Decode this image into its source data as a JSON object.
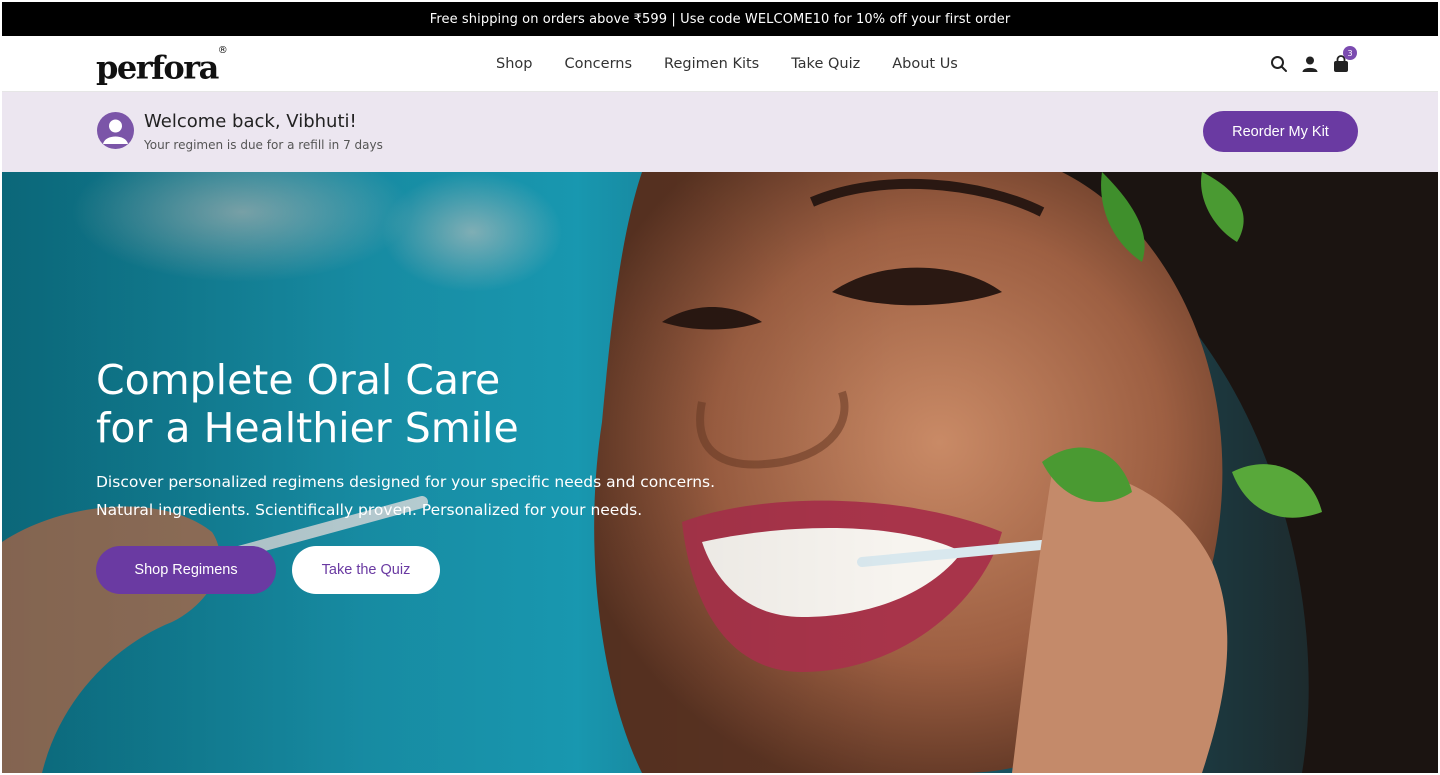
{
  "announcement": {
    "text": "Free shipping on orders above ₹599 | Use code WELCOME10 for 10% off your first order"
  },
  "header": {
    "logo_text": "perfora",
    "logo_mark": "®",
    "nav": [
      "Shop",
      "Concerns",
      "Regimen Kits",
      "Take Quiz",
      "About Us"
    ],
    "icons": [
      "search-icon",
      "user-icon",
      "cart-icon"
    ],
    "cart_count": "3"
  },
  "welcome": {
    "title": "Welcome back, Vibhuti!",
    "subtitle": "Your regimen is due for a refill in 7 days",
    "button": "Reorder My Kit"
  },
  "hero": {
    "title_line1": "Complete Oral Care",
    "title_line2": "for a Healthier Smile",
    "desc_line1": "Discover personalized regimens designed for your specific needs and concerns.",
    "desc_line2": "Natural ingredients. Scientifically proven. Personalized for your needs.",
    "primary_button": "Shop Regimens",
    "secondary_button": "Take the Quiz"
  },
  "colors": {
    "brand_purple": "#6a3aa2",
    "welcome_bg": "#ece6f0",
    "announce_bg": "#000000"
  }
}
